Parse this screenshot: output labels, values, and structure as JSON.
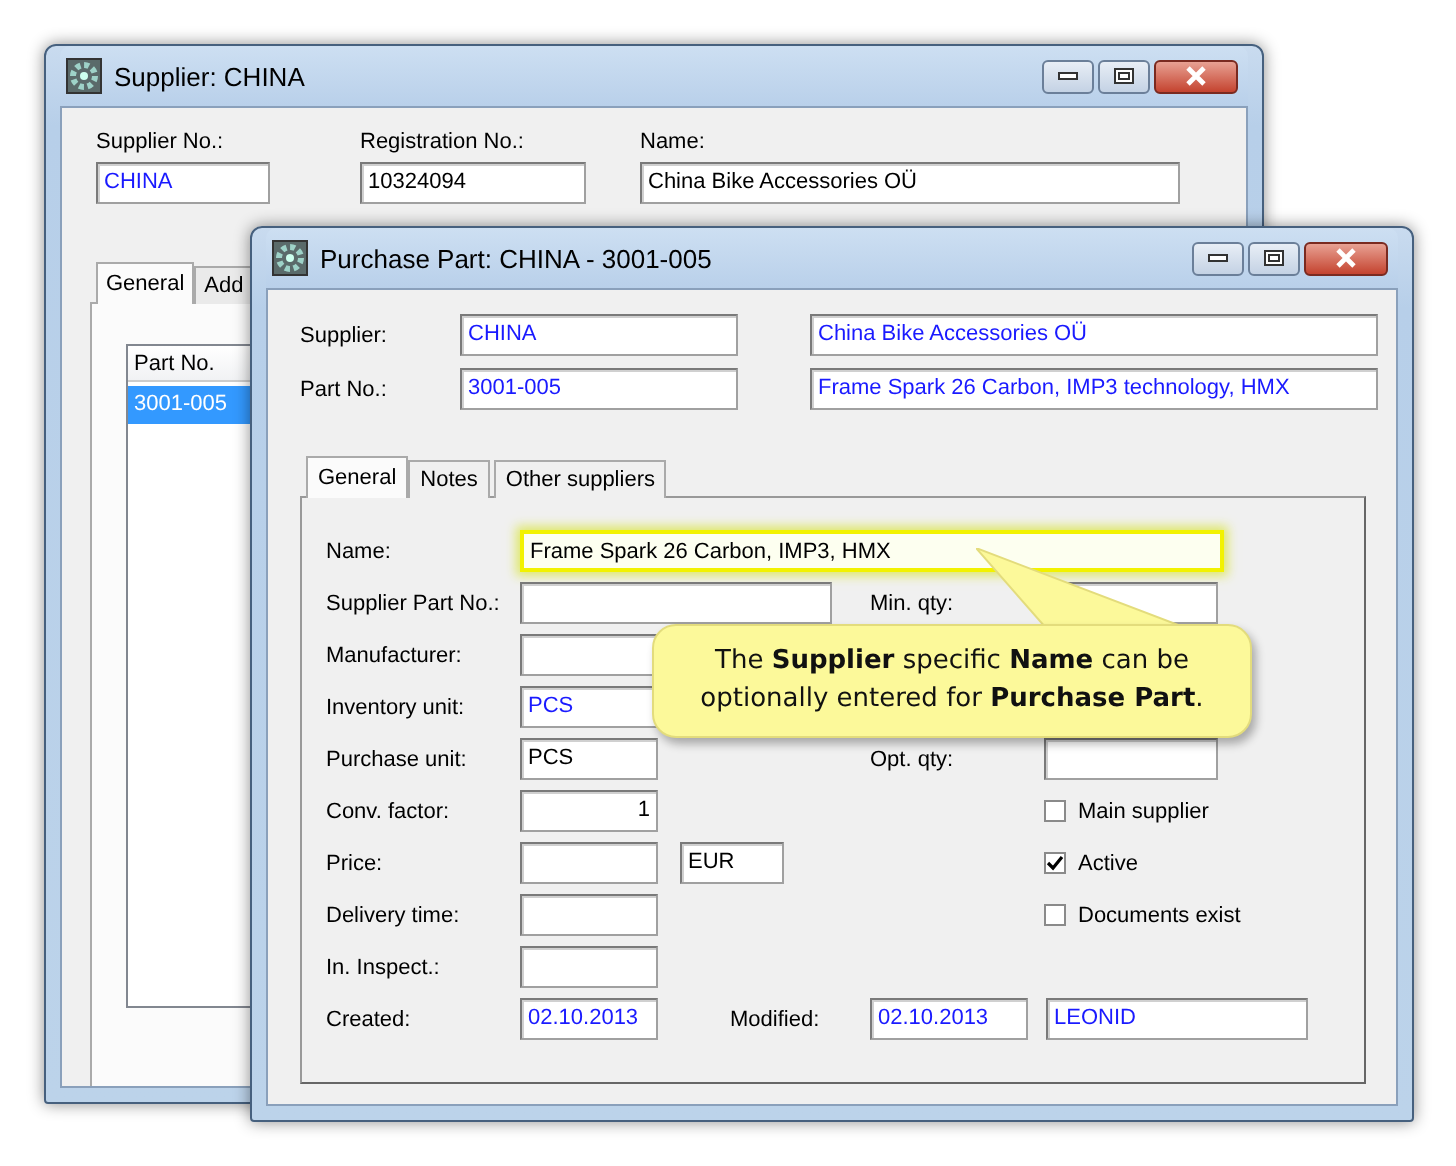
{
  "supplier_window": {
    "title": "Supplier: CHINA",
    "fields": [
      {
        "label": "Supplier No.:",
        "value": "CHINA",
        "readonly": true
      },
      {
        "label": "Registration No.:",
        "value": "10324094",
        "readonly": false
      },
      {
        "label": "Name:",
        "value": "China Bike Accessories OÜ",
        "readonly": false
      }
    ],
    "tabs": [
      {
        "label": "General",
        "selected": true
      },
      {
        "label": "Add",
        "selected": false
      }
    ],
    "parts_list": {
      "column": "Part No.",
      "rows": [
        {
          "text": "3001-005",
          "selected": true
        }
      ]
    }
  },
  "purchase_part_window": {
    "title": "Purchase Part: CHINA - 3001-005",
    "header_rows": [
      {
        "label": "Supplier:",
        "code": "CHINA",
        "description": "China Bike Accessories OÜ",
        "readonly": true
      },
      {
        "label": "Part No.:",
        "code": "3001-005",
        "description": "Frame Spark 26 Carbon, IMP3 technology, HMX",
        "readonly": true
      }
    ],
    "tabs": [
      {
        "label": "General",
        "selected": true
      },
      {
        "label": "Notes",
        "selected": false
      },
      {
        "label": "Other suppliers",
        "selected": false
      }
    ],
    "name_field": {
      "label": "Name:",
      "value": "Frame Spark 26 Carbon, IMP3, HMX",
      "highlighted": true
    },
    "rows": [
      {
        "kind": "long_text",
        "label": "Supplier Part No.:",
        "right": {
          "kind": "quantity",
          "label": "Min. qty:"
        }
      },
      {
        "kind": "long_text",
        "label": "Manufacturer:"
      },
      {
        "kind": "text",
        "label": "Inventory unit:",
        "value": "PCS",
        "readonly": true
      },
      {
        "kind": "text",
        "label": "Purchase unit:",
        "value": "PCS",
        "readonly": false,
        "right": {
          "kind": "quantity",
          "label": "Opt. qty:"
        }
      },
      {
        "kind": "number",
        "label": "Conv. factor:",
        "value": "1",
        "readonly": false,
        "right": {
          "kind": "checkbox",
          "label": "Main supplier",
          "checked": false
        }
      },
      {
        "kind": "price",
        "label": "Price:",
        "currency": "EUR",
        "right": {
          "kind": "checkbox",
          "label": "Active",
          "checked": true
        }
      },
      {
        "kind": "text",
        "label": "Delivery time:",
        "right": {
          "kind": "checkbox",
          "label": "Documents exist",
          "checked": false
        }
      },
      {
        "kind": "text",
        "label": "In. Inspect.:"
      },
      {
        "kind": "date",
        "label": "Created:",
        "value": "02.10.2013",
        "readonly": true,
        "right": {
          "kind": "modified",
          "label": "Modified:",
          "date": "02.10.2013",
          "user": "LEONID",
          "readonly": true
        }
      }
    ]
  },
  "callout": {
    "text": "The **Supplier** specific **Name** can be optionally entered for **Purchase Part**."
  }
}
